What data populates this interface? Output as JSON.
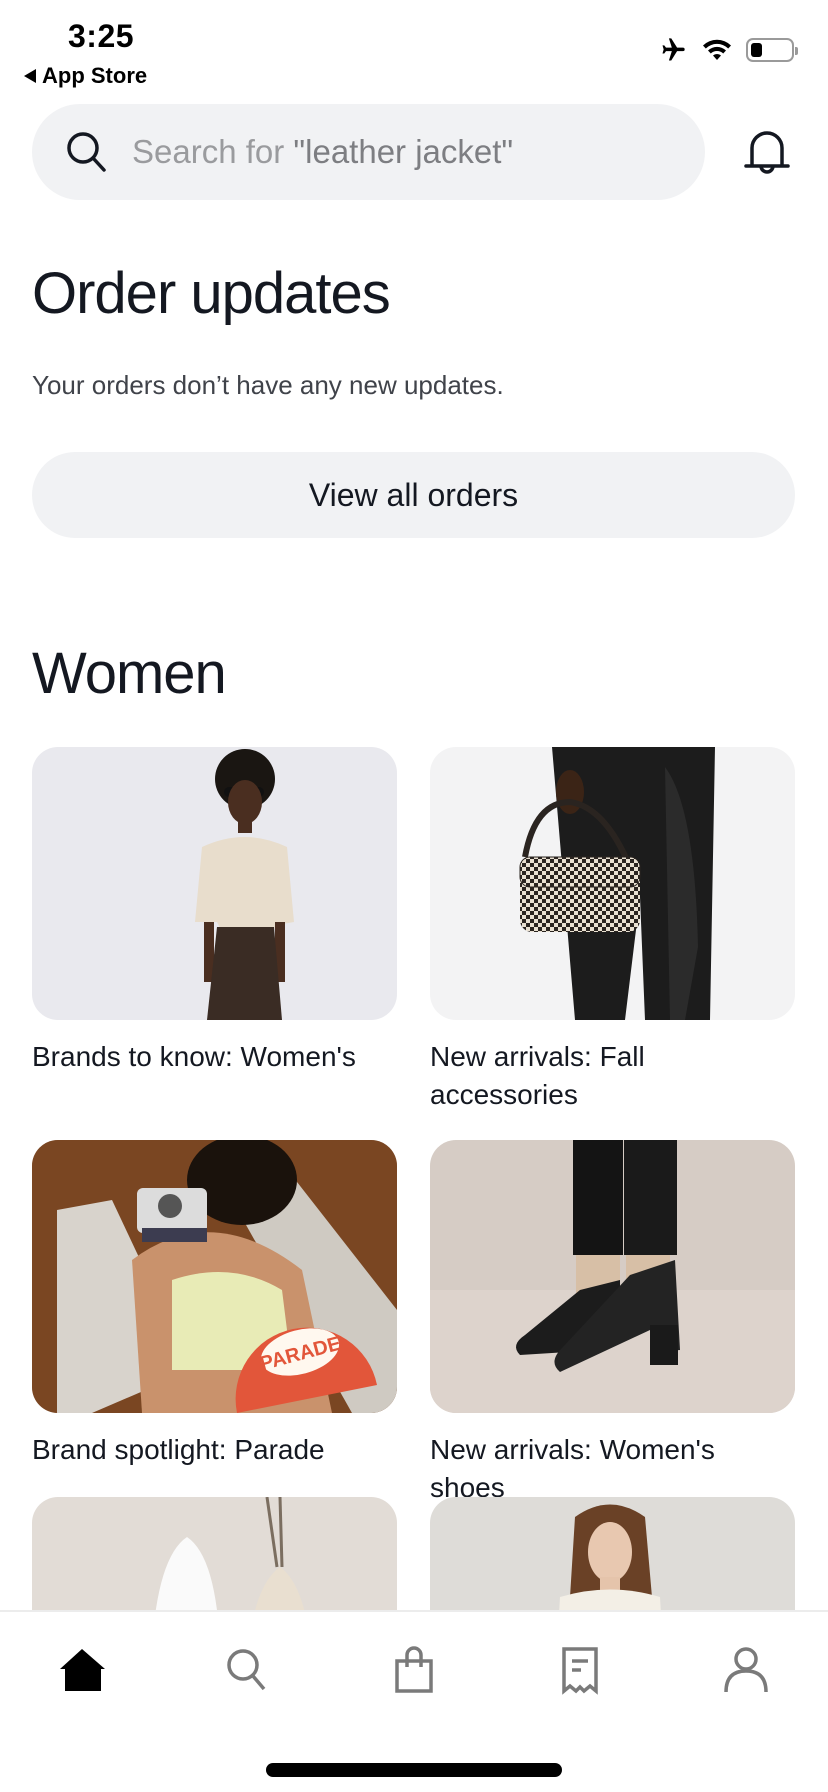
{
  "status_bar": {
    "time": "3:25",
    "back_label": "App Store",
    "icons": [
      "airplane-mode-icon",
      "wifi-icon",
      "battery-icon"
    ],
    "battery_level": 0.3
  },
  "search": {
    "placeholder_prefix": "Search for ",
    "placeholder_query": "\"leather jacket\""
  },
  "order_updates": {
    "title": "Order updates",
    "message": "Your orders don’t have any new updates.",
    "button_label": "View all orders"
  },
  "women": {
    "title": "Women",
    "cards": [
      {
        "label": "Brands to know: Women's",
        "image": "model-beige-top-brown-trousers"
      },
      {
        "label": "New arrivals: Fall accessories",
        "image": "houndstooth-handbag-leather-pants"
      },
      {
        "label": "Brand spotlight: Parade",
        "image": "woman-polaroid-camera-parade-logo",
        "badge": "PARADE"
      },
      {
        "label": "New arrivals: Women's shoes",
        "image": "black-ankle-boots"
      },
      {
        "label": "",
        "image": "ceramic-vases"
      },
      {
        "label": "",
        "image": "woman-portrait-cream-cardigan"
      }
    ]
  },
  "tab_bar": {
    "items": [
      {
        "name": "home",
        "icon": "home-icon",
        "active": true
      },
      {
        "name": "search",
        "icon": "search-icon",
        "active": false
      },
      {
        "name": "bag",
        "icon": "shopping-bag-icon",
        "active": false
      },
      {
        "name": "orders",
        "icon": "receipt-icon",
        "active": false
      },
      {
        "name": "account",
        "icon": "person-icon",
        "active": false
      }
    ]
  },
  "colors": {
    "text_primary": "#141821",
    "text_secondary": "#40434a",
    "placeholder": "#9a9b9e",
    "surface": "#f1f2f4",
    "icon_inactive": "#7a7a7a",
    "parade_red": "#e2563a"
  }
}
